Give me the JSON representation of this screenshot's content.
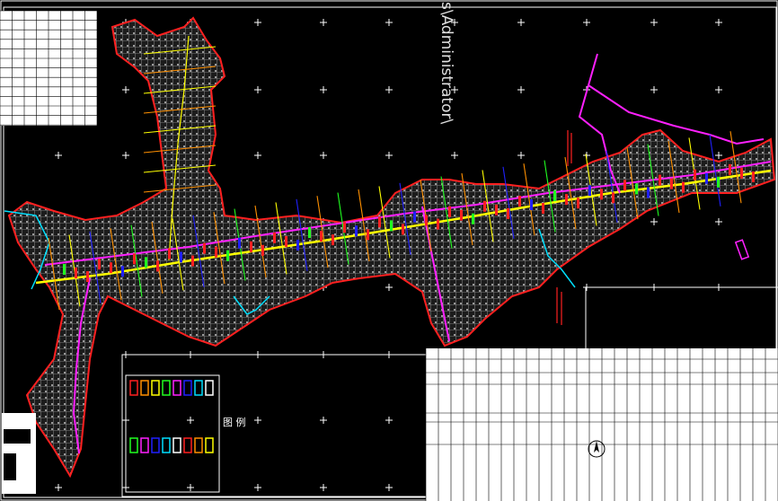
{
  "drawing": {
    "watermark_path": "s\\Administrator\\",
    "legend_title": "图 例",
    "background_color": "#000000",
    "colors": {
      "boundary": "#ff2020",
      "main_road": "#ffff00",
      "pipeline_magenta": "#ff20ff",
      "water_cyan": "#00e0ff",
      "blue_line": "#2020ff",
      "orange_line": "#ff9000",
      "green_line": "#20ff20",
      "parcel_fill": "#3a3a3a",
      "frame": "#ffffff"
    },
    "icons": [
      "crosshair-marker-icon",
      "north-arrow-icon"
    ]
  }
}
